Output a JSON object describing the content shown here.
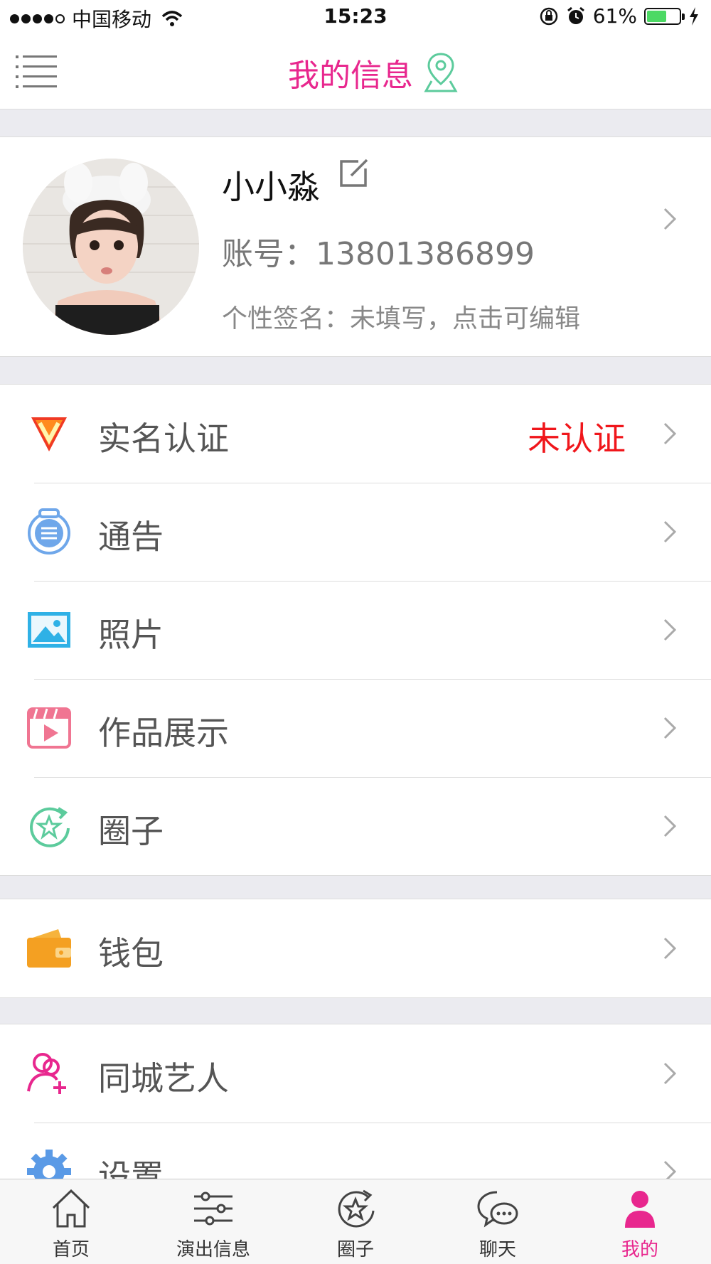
{
  "status_bar": {
    "carrier": "中国移动",
    "time": "15:23",
    "battery": "61%",
    "battery_level": 0.61
  },
  "header": {
    "title": "我的信息"
  },
  "profile": {
    "name": "小小淼",
    "account": "账号：13801386899",
    "signature": "个性签名：未填写，点击可编辑"
  },
  "menu": {
    "verify": {
      "label": "实名认证",
      "status": "未认证",
      "icon": "verify-v-icon"
    },
    "notice": {
      "label": "通告",
      "icon": "notice-list-icon"
    },
    "photos": {
      "label": "照片",
      "icon": "photo-icon"
    },
    "works": {
      "label": "作品展示",
      "icon": "video-play-icon"
    },
    "circle": {
      "label": "圈子",
      "icon": "circle-star-icon"
    },
    "wallet": {
      "label": "钱包",
      "icon": "wallet-icon"
    },
    "local_artists": {
      "label": "同城艺人",
      "icon": "add-people-icon"
    },
    "settings": {
      "label": "设置",
      "icon": "gear-icon"
    }
  },
  "tabs": [
    {
      "label": "首页",
      "icon": "home-icon"
    },
    {
      "label": "演出信息",
      "icon": "sliders-icon"
    },
    {
      "label": "圈子",
      "icon": "circle-star-icon"
    },
    {
      "label": "聊天",
      "icon": "chat-icon"
    },
    {
      "label": "我的",
      "icon": "person-icon"
    }
  ],
  "colors": {
    "accent": "#e8278e",
    "alert": "#f0161b",
    "green": "#5ccb9c"
  }
}
